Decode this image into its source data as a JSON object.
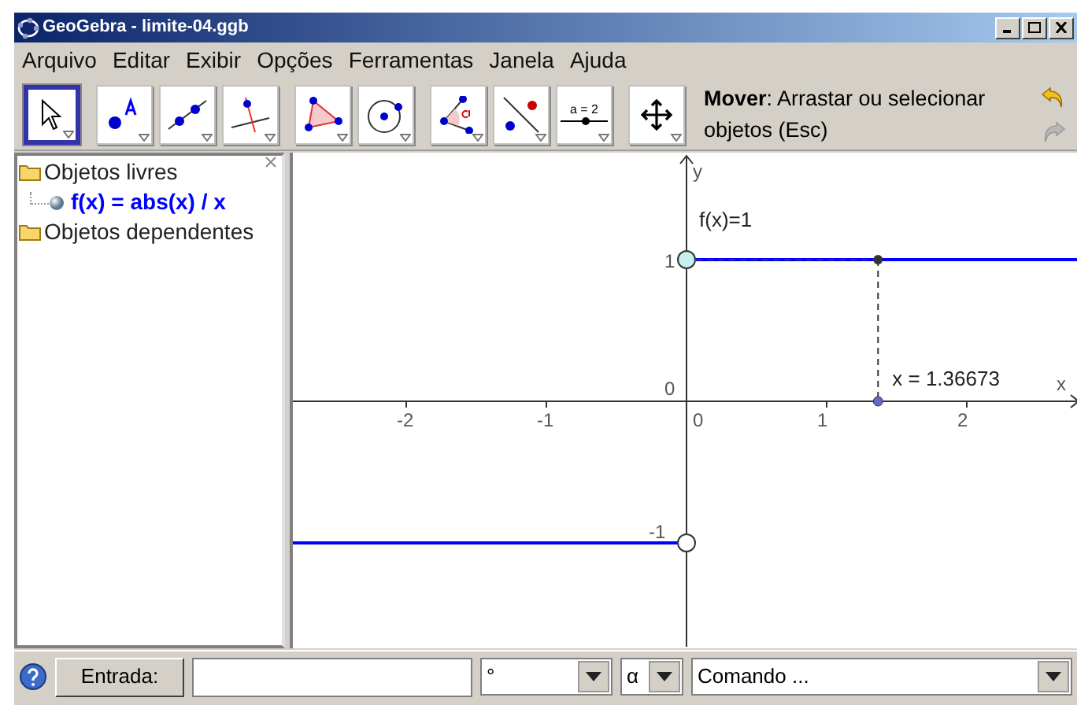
{
  "window": {
    "title": "GeoGebra - limite-04.ggb"
  },
  "menu": [
    "Arquivo",
    "Editar",
    "Exibir",
    "Opções",
    "Ferramentas",
    "Janela",
    "Ajuda"
  ],
  "toolbar": {
    "groups": [
      [
        {
          "kind": "pointer",
          "selected": true
        }
      ],
      [
        {
          "kind": "point",
          "selected": false
        },
        {
          "kind": "line",
          "selected": false
        },
        {
          "kind": "perpendicular",
          "selected": false
        }
      ],
      [
        {
          "kind": "polygon",
          "selected": false
        },
        {
          "kind": "circle",
          "selected": false
        }
      ],
      [
        {
          "kind": "angle",
          "selected": false
        },
        {
          "kind": "reflect",
          "selected": false
        },
        {
          "kind": "slider",
          "label": "a = 2",
          "selected": false
        }
      ],
      [
        {
          "kind": "move-view",
          "selected": false
        }
      ]
    ],
    "help": "**Mover**: Arrastar ou selecionar objetos (Esc)"
  },
  "algebra": {
    "folders": [
      {
        "label": "Objetos livres",
        "children": [
          "f(x) = abs(x) / x"
        ]
      },
      {
        "label": "Objetos dependentes"
      }
    ]
  },
  "graphics": {
    "x_axis_label": "x",
    "y_axis_label": "y",
    "x_ticks": [
      "-2",
      "-1",
      "0",
      "1",
      "2"
    ],
    "y_ticks": [
      "1",
      "0",
      "-1"
    ],
    "function_label": "f(x)=1",
    "point_label": "x = 1.36673"
  },
  "input_bar": {
    "button": "Entrada:",
    "degree": "°",
    "greek": "α",
    "command": "Comando ..."
  }
}
